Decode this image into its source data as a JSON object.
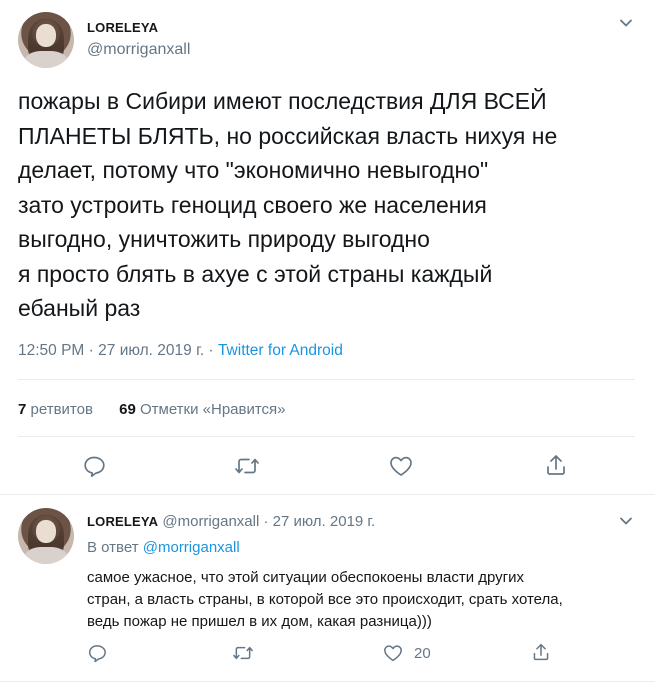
{
  "tweet": {
    "author_name": "LORELEYA",
    "author_handle": "@morriganxall",
    "text": "пожары в Сибири имеют последствия ДЛЯ ВСЕЙ\nПЛАНЕТЫ БЛЯТЬ, но российская власть нихуя не\nделает, потому что \"экономично невыгодно\"\nзато устроить геноцид своего же населения\nвыгодно, уничтожить природу выгодно\nя просто блять в ахуе с этой страны каждый\nебаный раз",
    "time": "12:50 PM",
    "sep1": " · ",
    "date": "27 июл. 2019 г.",
    "sep2": " · ",
    "source": "Twitter for Android",
    "retweets_count": "7",
    "retweets_label": " ретвитов",
    "likes_count": "69",
    "likes_label": " Отметки «Нравится»"
  },
  "reply": {
    "author_name": "LORELEYA",
    "author_handle": "@morriganxall",
    "sep": " · ",
    "date": "27 июл. 2019 г.",
    "reply_to_prefix": "В ответ ",
    "reply_to_handle": "@morriganxall",
    "text": "самое ужасное, что этой ситуации обеспокоены власти других\nстран, а власть страны, в которой все это происходит, срать хотела,\nведь пожар не пришел в их дом, какая разница)))",
    "like_count": "20"
  },
  "icons": {
    "reply": "reply-icon",
    "retweet": "retweet-icon",
    "like": "heart-icon",
    "share": "share-icon",
    "menu": "chevron-down-icon"
  },
  "colors": {
    "text": "#14171a",
    "muted": "#657786",
    "link": "#1b95e0",
    "divider": "#e6ecf0"
  }
}
